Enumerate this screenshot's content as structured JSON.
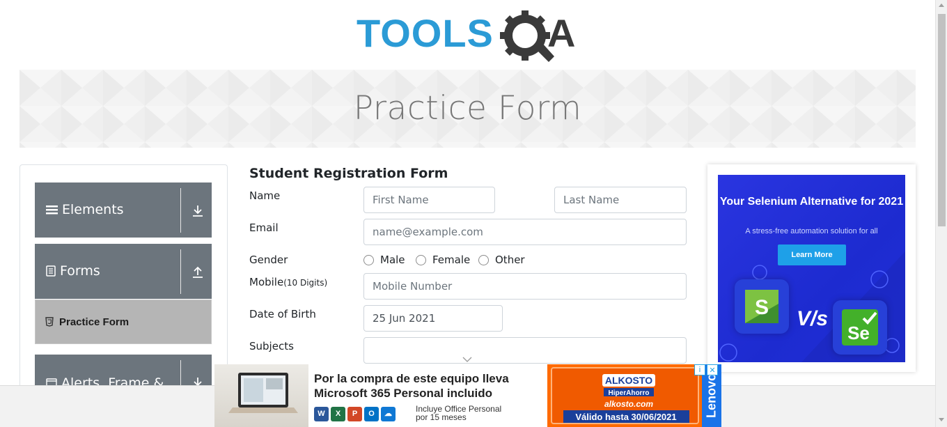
{
  "header": {
    "logo_text_left": "TOOLS",
    "logo_text_right": "A",
    "logo_alt": "TOOLSQA"
  },
  "banner": {
    "title": "Practice Form"
  },
  "sidebar": {
    "groups": [
      {
        "label": "Elements"
      },
      {
        "label": "Forms"
      },
      {
        "label": "Alerts, Frame &"
      }
    ],
    "active_item": "Practice Form"
  },
  "form": {
    "title": "Student Registration Form",
    "name_label": "Name",
    "first_name_placeholder": "First Name",
    "last_name_placeholder": "Last Name",
    "email_label": "Email",
    "email_placeholder": "name@example.com",
    "gender_label": "Gender",
    "gender_options": [
      "Male",
      "Female",
      "Other"
    ],
    "mobile_label": "Mobile",
    "mobile_hint": "(10 Digits)",
    "mobile_placeholder": "Mobile Number",
    "dob_label": "Date of Birth",
    "dob_value": "25 Jun 2021",
    "subjects_label": "Subjects"
  },
  "side_ad": {
    "headline": "Your Selenium Alternative for 2021",
    "subline": "A stress-free automation solution for all",
    "button": "Learn More",
    "vs": "V/s",
    "tile_left": "S",
    "tile_right": "Se"
  },
  "bottom_ad": {
    "headline_1": "Por la compra de este equipo lleva",
    "headline_2": "Microsoft 365 Personal incluido",
    "sub_1": "Incluye Office Personal",
    "sub_2": "por 15 meses",
    "brand_1": "ALKOSTO",
    "brand_2": "HiperAhorro",
    "brand_3": "alkosto.com",
    "brand_4": "Válido hasta 30/06/2021",
    "side_brand": "Lenovo"
  },
  "colors": {
    "accent_blue": "#2b9bd6",
    "sidebar_gray": "#6c757d",
    "ad_blue": "#2a35e0",
    "brand_orange": "#ff6a00"
  }
}
